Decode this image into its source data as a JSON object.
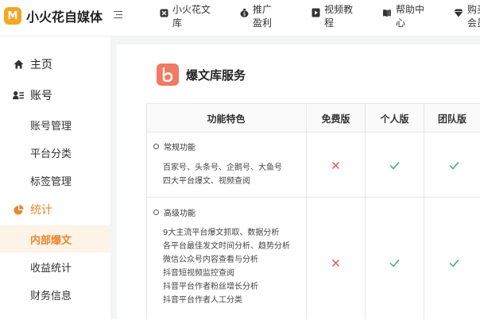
{
  "app": {
    "logo_letter": "M",
    "name": "小火花自媒体"
  },
  "nav": [
    {
      "label": "小火花文库",
      "icon": "library-icon"
    },
    {
      "label": "推广盈利",
      "icon": "money-bag-icon"
    },
    {
      "label": "视频教程",
      "icon": "video-icon"
    },
    {
      "label": "帮助中心",
      "icon": "book-icon"
    },
    {
      "label": "购买会员",
      "icon": "diamond-icon"
    }
  ],
  "sidebar": {
    "items": [
      {
        "label": "主页",
        "type": "group",
        "icon": "home-icon"
      },
      {
        "label": "账号",
        "type": "group",
        "icon": "account-icon"
      },
      {
        "label": "账号管理",
        "type": "sub"
      },
      {
        "label": "平台分类",
        "type": "sub"
      },
      {
        "label": "标签管理",
        "type": "sub"
      },
      {
        "label": "统计",
        "type": "group",
        "icon": "pie-chart-icon"
      },
      {
        "label": "内部爆文",
        "type": "sub",
        "active": true
      },
      {
        "label": "收益统计",
        "type": "sub"
      },
      {
        "label": "财务信息",
        "type": "sub"
      }
    ]
  },
  "service": {
    "title": "爆文库服务",
    "logo_letter": "b"
  },
  "table": {
    "headers": [
      "功能特色",
      "免费版",
      "个人版",
      "团队版"
    ],
    "rows": [
      {
        "title": "常规功能",
        "lines": [
          "百家号、头条号、企鹅号、大鱼号",
          "四大平台爆文、视频查阅"
        ],
        "free": "✕",
        "personal": "✓",
        "team": "✓"
      },
      {
        "title": "高级功能",
        "lines": [
          "9大主流平台爆文抓取、数据分析",
          "各平台最佳发文时间分析、趋势分析",
          "微信公众号内容查看与分析",
          "抖音短视频监控查阅",
          "抖音平台作者粉丝增长分析",
          "抖音平台作者人工分类"
        ],
        "free": "✕",
        "personal": "✓",
        "team": "✓"
      }
    ]
  },
  "colors": {
    "accent": "#e8872c",
    "cross": "#e05a4f",
    "check": "#3bb06a",
    "service_logo": "#f07a62"
  }
}
